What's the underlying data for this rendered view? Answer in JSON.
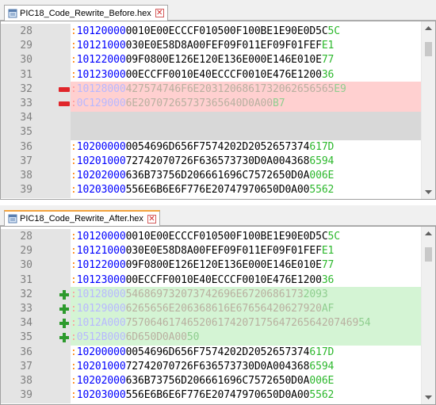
{
  "before": {
    "tab_title": "PIC18_Code_Rewrite_Before.hex",
    "lines": [
      {
        "num": "28",
        "kind": "normal",
        "colon": ":",
        "blue": "10120000",
        "mid": "0010E00ECCCF010500F100BE1E90E0D5C",
        "green": "5C"
      },
      {
        "num": "29",
        "kind": "normal",
        "colon": ":",
        "blue": "10121000",
        "mid": "030E0E58D8A00FEF09F011EF09F01FEF",
        "green": "E1"
      },
      {
        "num": "30",
        "kind": "normal",
        "colon": ":",
        "blue": "10122000",
        "mid": "09F0800E126E120E136E000E146E010E",
        "green": "77"
      },
      {
        "num": "31",
        "kind": "normal",
        "colon": ":",
        "blue": "10123000",
        "mid": "00ECCFF0010E40ECCCF0010E476E1200",
        "green": "36"
      },
      {
        "num": "32",
        "kind": "removed",
        "colon": ":",
        "blue": "10128000",
        "mid": "427574746F6E2031206861732062656565",
        "green": "E9"
      },
      {
        "num": "33",
        "kind": "removed",
        "colon": ":",
        "blue": "0C129000",
        "mid": "6E20707265737365640D0A00",
        "green": "B7"
      },
      {
        "num": "34",
        "kind": "empty",
        "colon": "",
        "blue": "",
        "mid": "",
        "green": ""
      },
      {
        "num": "35",
        "kind": "empty",
        "colon": "",
        "blue": "",
        "mid": "",
        "green": ""
      },
      {
        "num": "36",
        "kind": "normal",
        "colon": ":",
        "blue": "10200000",
        "mid": "0054696D656F7574202D2052657374",
        "green": "617D"
      },
      {
        "num": "37",
        "kind": "normal",
        "colon": ":",
        "blue": "10201000",
        "mid": "72742070726F636573730D0A004368",
        "green": "6594"
      },
      {
        "num": "38",
        "kind": "normal",
        "colon": ":",
        "blue": "10202000",
        "mid": "636B73756D206661696C7572650D0A",
        "green": "006E"
      },
      {
        "num": "39",
        "kind": "normal",
        "colon": ":",
        "blue": "10203000",
        "mid": "556E6B6E6F776E20747970650D0A00",
        "green": "5562"
      }
    ]
  },
  "after": {
    "tab_title": "PIC18_Code_Rewrite_After.hex",
    "lines": [
      {
        "num": "28",
        "kind": "normal",
        "colon": ":",
        "blue": "10120000",
        "mid": "0010E00ECCCF010500F100BE1E90E0D5C",
        "green": "5C"
      },
      {
        "num": "29",
        "kind": "normal",
        "colon": ":",
        "blue": "10121000",
        "mid": "030E0E58D8A00FEF09F011EF09F01FEF",
        "green": "E1"
      },
      {
        "num": "30",
        "kind": "normal",
        "colon": ":",
        "blue": "10122000",
        "mid": "09F0800E126E120E136E000E146E010E",
        "green": "77"
      },
      {
        "num": "31",
        "kind": "normal",
        "colon": ":",
        "blue": "10123000",
        "mid": "00ECCFF0010E40ECCCF0010E476E1200",
        "green": "36"
      },
      {
        "num": "32",
        "kind": "added",
        "colon": ":",
        "blue": "10128000",
        "mid": "546869732073742696E6720686173",
        "green": "2093"
      },
      {
        "num": "33",
        "kind": "added",
        "colon": ":",
        "blue": "10129000",
        "mid": "6265656E206368616E67656420627920",
        "green": "AF"
      },
      {
        "num": "34",
        "kind": "added",
        "colon": ":",
        "blue": "1012A000",
        "mid": "75706461746520617420717564726564207469",
        "green": "54"
      },
      {
        "num": "35",
        "kind": "added",
        "colon": ":",
        "blue": "0512B000",
        "mid": "6D650D0A00",
        "green": "50"
      },
      {
        "num": "36",
        "kind": "normal",
        "colon": ":",
        "blue": "10200000",
        "mid": "0054696D656F7574202D2052657374",
        "green": "617D"
      },
      {
        "num": "37",
        "kind": "normal",
        "colon": ":",
        "blue": "10201000",
        "mid": "72742070726F636573730D0A004368",
        "green": "6594"
      },
      {
        "num": "38",
        "kind": "normal",
        "colon": ":",
        "blue": "10202000",
        "mid": "636B73756D206661696C7572650D0A",
        "green": "006E"
      },
      {
        "num": "39",
        "kind": "normal",
        "colon": ":",
        "blue": "10203000",
        "mid": "556E6B6E6F776E20747970650D0A00",
        "green": "5562"
      }
    ]
  },
  "icons": {
    "tab_icon": "file-icon",
    "close": "close-icon",
    "removed_marker": "minus-icon",
    "added_marker": "plus-icon"
  },
  "colors": {
    "address": "#0000ff",
    "colon": "#ff8000",
    "checksum": "#2db82d",
    "removed_bg": "#ffd0d0",
    "added_bg": "#d4f4d4"
  }
}
